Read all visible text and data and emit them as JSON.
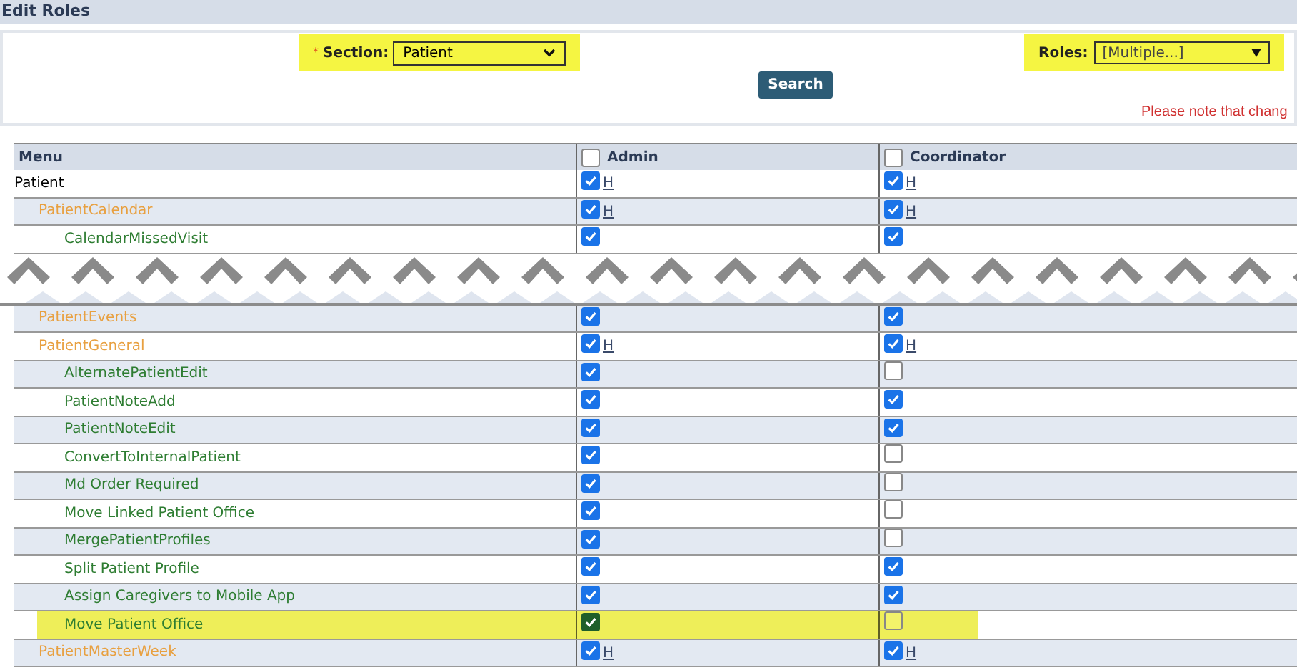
{
  "title": "Edit Roles",
  "filters": {
    "section": {
      "required_mark": "*",
      "label": "Section:",
      "value": "Patient",
      "highlighted": true
    },
    "roles": {
      "label": "Roles:",
      "value": "[Multiple...]",
      "highlighted": true
    },
    "search_button": "Search",
    "notice": "Please note that chang"
  },
  "table": {
    "columns": [
      {
        "label": "Menu"
      },
      {
        "label": "Admin",
        "checked": false
      },
      {
        "label": "Coordinator",
        "checked": false
      }
    ],
    "rows": [
      {
        "kind": "row",
        "label": "Patient",
        "admin": true,
        "coordinator": true,
        "admin_link": "H",
        "coordinator_link": "H",
        "highlighted": false,
        "children": [
          {
            "kind": "row",
            "label": "PatientCalendar",
            "admin": true,
            "coordinator": true,
            "admin_link": "H",
            "coordinator_link": "H",
            "highlighted": false,
            "children": [
              {
                "kind": "row",
                "label": "CalendarMissedVisit",
                "admin": true,
                "coordinator": true,
                "highlighted": false
              },
              {
                "kind": "tear"
              }
            ]
          },
          {
            "kind": "row",
            "label": "PatientEvents",
            "admin": true,
            "coordinator": true,
            "highlighted": false
          },
          {
            "kind": "row",
            "label": "PatientGeneral",
            "admin": true,
            "coordinator": true,
            "admin_link": "H",
            "coordinator_link": "H",
            "highlighted": false,
            "children": [
              {
                "kind": "row",
                "label": "AlternatePatientEdit",
                "admin": true,
                "coordinator": false,
                "highlighted": false
              },
              {
                "kind": "row",
                "label": "PatientNoteAdd",
                "admin": true,
                "coordinator": true,
                "highlighted": false
              },
              {
                "kind": "row",
                "label": "PatientNoteEdit",
                "admin": true,
                "coordinator": true,
                "highlighted": false
              },
              {
                "kind": "row",
                "label": "ConvertToInternalPatient",
                "admin": true,
                "coordinator": false,
                "highlighted": false
              },
              {
                "kind": "row",
                "label": "Md Order Required",
                "admin": true,
                "coordinator": false,
                "highlighted": false
              },
              {
                "kind": "row",
                "label": "Move Linked Patient Office",
                "admin": true,
                "coordinator": false,
                "highlighted": false
              },
              {
                "kind": "row",
                "label": "MergePatientProfiles",
                "admin": true,
                "coordinator": false,
                "highlighted": false
              },
              {
                "kind": "row",
                "label": "Split Patient Profile",
                "admin": true,
                "coordinator": true,
                "highlighted": false
              },
              {
                "kind": "row",
                "label": "Assign Caregivers to Mobile App",
                "admin": true,
                "coordinator": true,
                "highlighted": false
              },
              {
                "kind": "row",
                "label": "Move Patient Office",
                "admin": true,
                "coordinator": false,
                "highlighted": true
              }
            ]
          },
          {
            "kind": "row",
            "label": "PatientMasterWeek",
            "admin": true,
            "coordinator": true,
            "admin_link": "H",
            "coordinator_link": "H",
            "highlighted": false
          }
        ]
      }
    ]
  }
}
